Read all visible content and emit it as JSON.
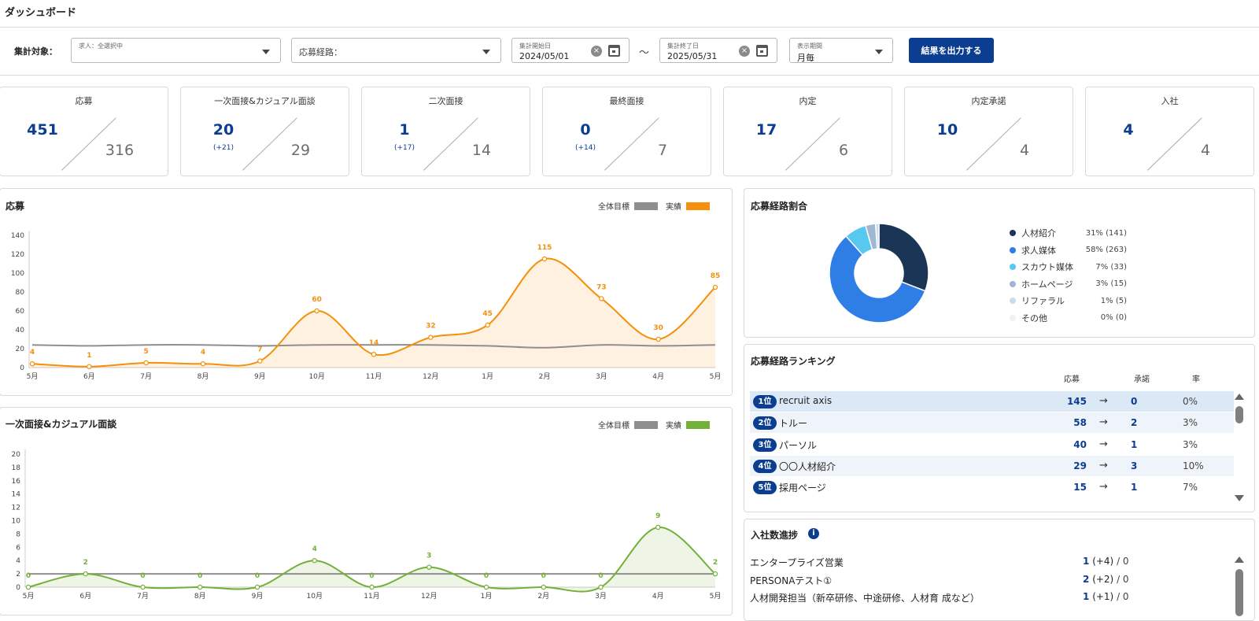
{
  "page": {
    "title": "ダッシュボード"
  },
  "filters": {
    "target_label": "集計対象：",
    "job": {
      "small_label": "求人：全選択中"
    },
    "channel": {
      "label": "応募経路："
    },
    "start_date": {
      "small_label": "集計開始日",
      "value": "2024/05/01"
    },
    "tilde": "～",
    "end_date": {
      "small_label": "集計終了日",
      "value": "2025/05/31"
    },
    "period": {
      "small_label": "表示期間",
      "value": "月毎"
    },
    "export_label": "結果を出力する"
  },
  "kpis": [
    {
      "name": "応募",
      "value": "451",
      "delta": "",
      "target": "316"
    },
    {
      "name": "一次面接&カジュアル面談",
      "value": "20",
      "delta": "(+21)",
      "target": "29"
    },
    {
      "name": "二次面接",
      "value": "1",
      "delta": "(+17)",
      "target": "14"
    },
    {
      "name": "最終面接",
      "value": "0",
      "delta": "(+14)",
      "target": "7"
    },
    {
      "name": "内定",
      "value": "17",
      "delta": "",
      "target": "6"
    },
    {
      "name": "内定承諾",
      "value": "10",
      "delta": "",
      "target": "4"
    },
    {
      "name": "入社",
      "value": "4",
      "delta": "",
      "target": "4"
    }
  ],
  "legend_labels": {
    "target": "全体目標",
    "actual": "実績"
  },
  "colors": {
    "brand": "#0b3d91",
    "orange": "#f4900c",
    "green": "#72b037",
    "target_gray": "#8f8f8f",
    "donut": [
      "#1b3556",
      "#2f7ee6",
      "#57c8f0",
      "#9fb7d3",
      "#c7dcee",
      "#eef2f7"
    ]
  },
  "chart_data": [
    {
      "type": "area",
      "title": "応募",
      "categories": [
        "5月",
        "6月",
        "7月",
        "8月",
        "9月",
        "10月",
        "11月",
        "12月",
        "1月",
        "2月",
        "3月",
        "4月",
        "5月"
      ],
      "series": [
        {
          "name": "実績",
          "values": [
            4,
            1,
            5,
            4,
            7,
            60,
            14,
            32,
            45,
            115,
            73,
            30,
            85
          ]
        },
        {
          "name": "全体目標",
          "values": [
            24,
            23,
            24,
            24,
            23,
            24,
            24,
            24,
            23,
            21,
            24,
            23,
            24
          ]
        }
      ],
      "yticks": [
        0,
        20,
        40,
        60,
        80,
        100,
        120,
        140
      ],
      "ylim": [
        0,
        140
      ],
      "legend": "top-right",
      "grid": false
    },
    {
      "type": "area",
      "title": "一次面接&カジュアル面談",
      "categories": [
        "5月",
        "6月",
        "7月",
        "8月",
        "9月",
        "10月",
        "11月",
        "12月",
        "1月",
        "2月",
        "3月",
        "4月",
        "5月"
      ],
      "series": [
        {
          "name": "実績",
          "values": [
            0,
            2,
            0,
            0,
            0,
            4,
            0,
            3,
            0,
            0,
            0,
            9,
            2
          ]
        },
        {
          "name": "全体目標",
          "values": [
            2,
            2,
            2,
            2,
            2,
            2,
            2,
            2,
            2,
            2,
            2,
            2,
            2
          ]
        }
      ],
      "yticks": [
        0,
        2,
        4,
        6,
        8,
        10,
        12,
        14,
        16,
        18,
        20
      ],
      "ylim": [
        0,
        20
      ],
      "legend": "top-right",
      "grid": false
    },
    {
      "type": "pie",
      "title": "応募経路割合",
      "slices": [
        {
          "label": "人材紹介",
          "value": 141,
          "pct": "31% (141)"
        },
        {
          "label": "求人媒体",
          "value": 263,
          "pct": "58% (263)"
        },
        {
          "label": "スカウト媒体",
          "value": 33,
          "pct": "7% (33)"
        },
        {
          "label": "ホームページ",
          "value": 15,
          "pct": "3% (15)"
        },
        {
          "label": "リファラル",
          "value": 5,
          "pct": "1% (5)"
        },
        {
          "label": "その他",
          "value": 0,
          "pct": "0% (0)"
        }
      ],
      "legend": "right"
    }
  ],
  "ranking": {
    "title": "応募経路ランキング",
    "headers": {
      "applications": "応募",
      "accepted": "承諾",
      "rate": "率"
    },
    "arrow": "→",
    "rows": [
      {
        "rank": "1位",
        "name": "recruit axis",
        "applications": "145",
        "accepted": "0",
        "rate": "0%"
      },
      {
        "rank": "2位",
        "name": "トルー",
        "applications": "58",
        "accepted": "2",
        "rate": "3%"
      },
      {
        "rank": "3位",
        "name": "パーソル",
        "applications": "40",
        "accepted": "1",
        "rate": "3%"
      },
      {
        "rank": "4位",
        "name": "〇〇人材紹介",
        "applications": "29",
        "accepted": "3",
        "rate": "10%"
      },
      {
        "rank": "5位",
        "name": "採用ページ",
        "applications": "15",
        "accepted": "1",
        "rate": "7%"
      }
    ]
  },
  "progress": {
    "title": "入社数進捗",
    "info_icon": "info-icon",
    "rows": [
      {
        "name": "エンタープライズ営業",
        "count": "1",
        "delta": "(+4)",
        "goal": "/ 0"
      },
      {
        "name": "PERSONAテスト①",
        "count": "2",
        "delta": "(+2)",
        "goal": "/ 0"
      },
      {
        "name": "人材開発担当（新卒研修、中途研修、人材育 成など）",
        "count": "1",
        "delta": "(+1)",
        "goal": "/ 0"
      }
    ]
  }
}
